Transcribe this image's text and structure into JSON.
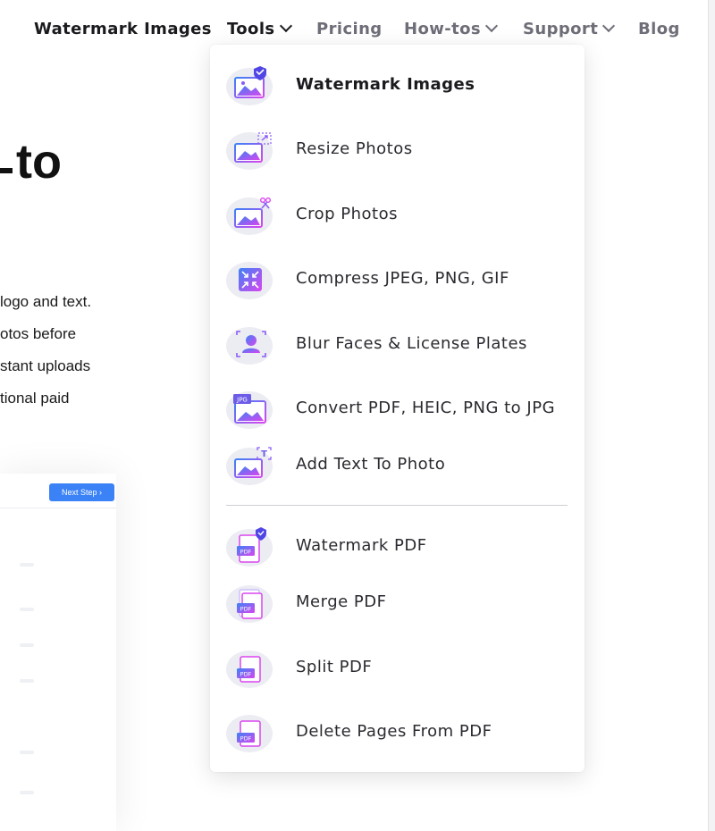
{
  "nav": {
    "brand": "Watermark Images",
    "tools": "Tools",
    "pricing": "Pricing",
    "howtos": "How-tos",
    "support": "Support",
    "blog": "Blog"
  },
  "hero": {
    "title_fragment": "to",
    "lines": [
      "logo and text.",
      "otos before",
      "stant uploads",
      "tional paid"
    ]
  },
  "preview": {
    "next_step": "Next Step ›"
  },
  "dropdown": {
    "images": [
      {
        "label": "Watermark Images",
        "icon": "watermark-image-icon"
      },
      {
        "label": "Resize Photos",
        "icon": "resize-photo-icon"
      },
      {
        "label": "Crop Photos",
        "icon": "crop-photo-icon"
      },
      {
        "label": "Compress JPEG, PNG, GIF",
        "icon": "compress-icon"
      },
      {
        "label": "Blur Faces & License Plates",
        "icon": "blur-face-icon"
      },
      {
        "label": "Convert PDF, HEIC, PNG to JPG",
        "icon": "convert-jpg-icon"
      },
      {
        "label": "Add Text To Photo",
        "icon": "add-text-icon"
      }
    ],
    "pdf": [
      {
        "label": "Watermark PDF",
        "icon": "watermark-pdf-icon"
      },
      {
        "label": "Merge PDF",
        "icon": "merge-pdf-icon"
      },
      {
        "label": "Split PDF",
        "icon": "split-pdf-icon"
      },
      {
        "label": "Delete Pages From PDF",
        "icon": "delete-pages-pdf-icon"
      }
    ],
    "icon_text": {
      "jpg": "JPG",
      "pdf": "PDF",
      "text": "T"
    }
  },
  "colors": {
    "accent_purple": "#8b5cf6",
    "accent_blue": "#3b82f6",
    "accent_pink": "#d946ef"
  }
}
